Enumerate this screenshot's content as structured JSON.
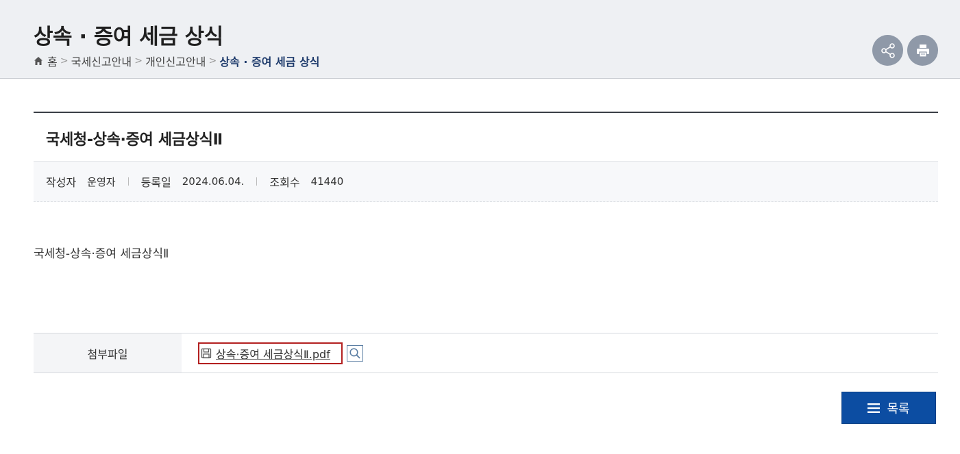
{
  "header": {
    "title": "상속 · 증여 세금 상식",
    "breadcrumb": [
      "홈",
      "국세신고안내",
      "개인신고안내",
      "상속 · 증여 세금 상식"
    ],
    "icons": [
      "home-icon",
      "share-icon",
      "print-icon"
    ]
  },
  "article": {
    "title": "국세청-상속·증여 세금상식Ⅱ",
    "meta": {
      "author_label": "작성자",
      "author": "운영자",
      "date_label": "등록일",
      "date": "2024.06.04.",
      "views_label": "조회수",
      "views": "41440"
    },
    "body": "국세청-상속·증여 세금상식Ⅱ"
  },
  "attachment": {
    "label": "첨부파일",
    "file_name": "상속·증여 세금상식Ⅱ.pdf",
    "icons": [
      "floppy-disk-icon",
      "magnifier-icon"
    ]
  },
  "actions": {
    "list_label": "목록",
    "list_icon": "menu-icon"
  },
  "colors": {
    "header_bg": "#eef0f3",
    "primary_button": "#0c4da2",
    "breadcrumb_current": "#1d3a6b",
    "highlight_border": "#b32020"
  }
}
